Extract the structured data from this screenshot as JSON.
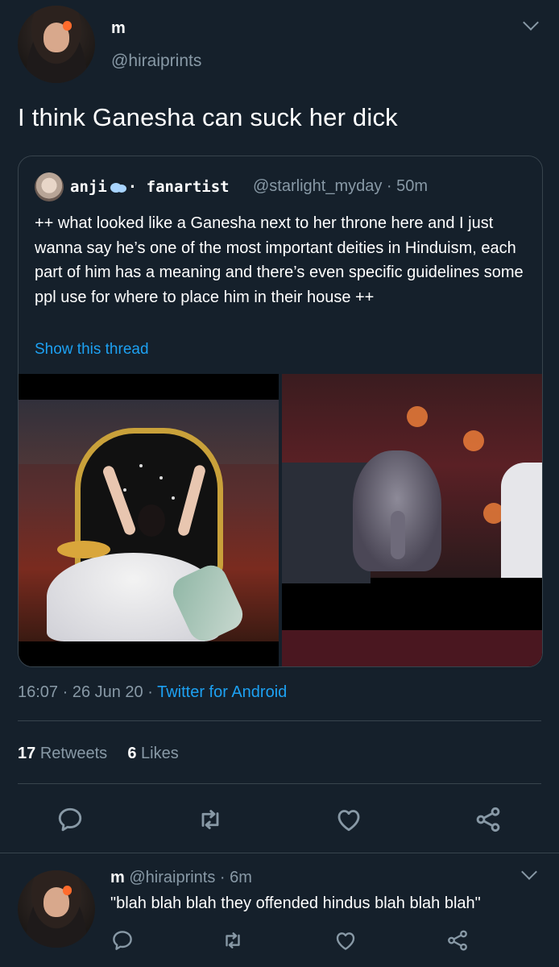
{
  "tweet": {
    "author_name": "m",
    "author_handle": "@hiraiprints",
    "text": "I think Ganesha can suck her dick",
    "timestamp": "16:07 · 26 Jun 20 · ",
    "source": "Twitter for Android",
    "retweets_count": "17",
    "retweets_label": "Retweets",
    "likes_count": "6",
    "likes_label": "Likes"
  },
  "quoted": {
    "display_name": "anji",
    "display_suffix": "· fanartist",
    "handle_time": "@starlight_myday · 50m",
    "text": "++ what looked like a Ganesha next to her throne here and I just wanna say he’s one of the most important deities in Hinduism, each part of him has a meaning and there’s even specific guidelines some ppl use for where to place him in their house ++",
    "show_thread": "Show this thread"
  },
  "reply": {
    "author_name": "m",
    "meta": " @hiraiprints · 6m",
    "text": "\"blah blah blah they offended hindus blah blah blah\""
  },
  "icons": [
    "reply-icon",
    "retweet-icon",
    "like-icon",
    "share-icon",
    "chevron-down-icon"
  ],
  "colors": {
    "background": "#15202b",
    "muted": "#8899a6",
    "link": "#1da1f2",
    "border": "#38444d"
  }
}
